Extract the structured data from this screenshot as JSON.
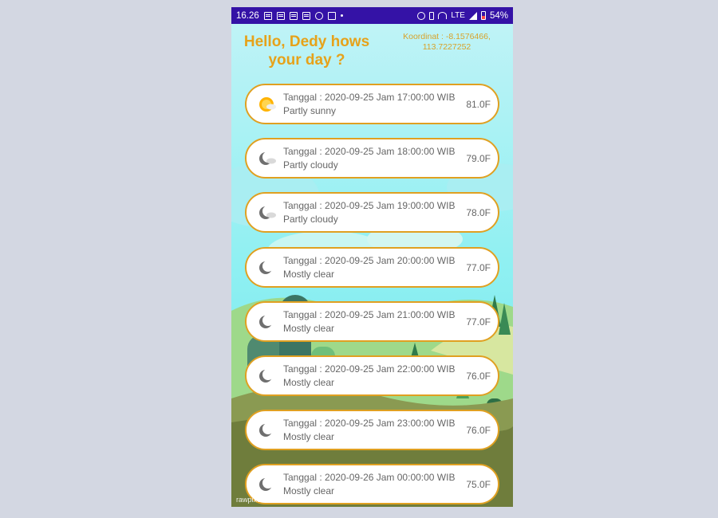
{
  "status_bar": {
    "time": "16.26",
    "network": "LTE",
    "battery": "54%"
  },
  "header": {
    "greeting": "Hello, Dedy hows your day ?",
    "coordinates_line1": "Koordinat : -8.1576466,",
    "coordinates_line2": "113.7227252"
  },
  "forecasts": [
    {
      "datetime": "Tanggal : 2020-09-25 Jam 17:00:00 WIB",
      "condition": "Partly sunny",
      "temperature": "81.0F",
      "icon": "partly-sunny-icon"
    },
    {
      "datetime": "Tanggal : 2020-09-25 Jam 18:00:00 WIB",
      "condition": "Partly cloudy",
      "temperature": "79.0F",
      "icon": "partly-cloudy-night-icon"
    },
    {
      "datetime": "Tanggal : 2020-09-25 Jam 19:00:00 WIB",
      "condition": "Partly cloudy",
      "temperature": "78.0F",
      "icon": "partly-cloudy-night-icon"
    },
    {
      "datetime": "Tanggal : 2020-09-25 Jam 20:00:00 WIB",
      "condition": "Mostly clear",
      "temperature": "77.0F",
      "icon": "moon-icon"
    },
    {
      "datetime": "Tanggal : 2020-09-25 Jam 21:00:00 WIB",
      "condition": "Mostly clear",
      "temperature": "77.0F",
      "icon": "moon-icon"
    },
    {
      "datetime": "Tanggal : 2020-09-25 Jam 22:00:00 WIB",
      "condition": "Mostly clear",
      "temperature": "76.0F",
      "icon": "moon-icon"
    },
    {
      "datetime": "Tanggal : 2020-09-25 Jam 23:00:00 WIB",
      "condition": "Mostly clear",
      "temperature": "76.0F",
      "icon": "moon-icon"
    },
    {
      "datetime": "Tanggal : 2020-09-26 Jam 00:00:00 WIB",
      "condition": "Mostly clear",
      "temperature": "75.0F",
      "icon": "moon-icon"
    }
  ],
  "watermark": "rawpixel",
  "colors": {
    "status_bar": "#3412a6",
    "accent": "#e0a021",
    "sky": "#b9f1f5",
    "card_text": "#666666"
  }
}
